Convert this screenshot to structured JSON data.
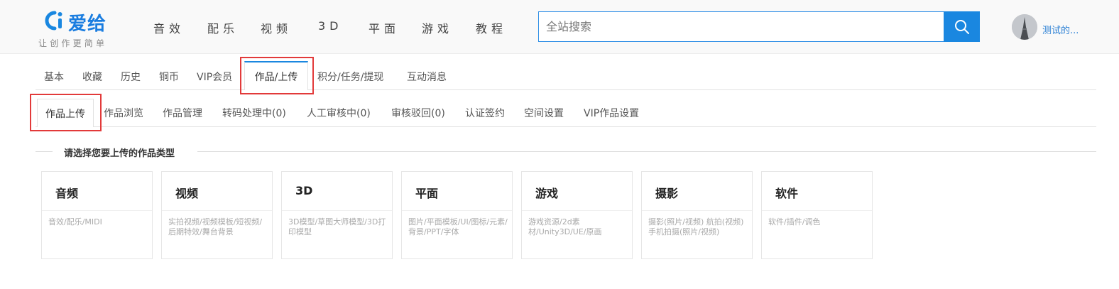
{
  "colors": {
    "brand": "#1a87e0",
    "highlight": "#e23a3a",
    "link": "#2a7fd4"
  },
  "header": {
    "logo": {
      "mark": "Ci",
      "name": "爱给",
      "slogan": "让创作更简单"
    },
    "nav": [
      "音效",
      "配乐",
      "视频",
      "3D",
      "平面",
      "游戏",
      "教程"
    ],
    "search": {
      "placeholder": "全站搜索",
      "icon": "search-icon"
    },
    "user": {
      "name": "测试的..."
    }
  },
  "tabs": {
    "items": [
      "基本",
      "收藏",
      "历史",
      "铜币",
      "VIP会员",
      "作品/上传",
      "积分/任务/提现",
      "互动消息"
    ],
    "active": "作品/上传"
  },
  "subtabs": {
    "items": [
      "作品上传",
      "作品浏览",
      "作品管理",
      "转码处理中(0)",
      "人工审核中(0)",
      "审核驳回(0)",
      "认证签约",
      "空间设置",
      "VIP作品设置"
    ],
    "active": "作品上传"
  },
  "section": {
    "title": "请选择您要上传的作品类型"
  },
  "cards": [
    {
      "title": "音频",
      "desc": "音效/配乐/MIDI"
    },
    {
      "title": "视频",
      "desc": "实拍视频/视频模板/短视频/后期特效/舞台背景"
    },
    {
      "title": "3D",
      "desc": "3D模型/草图大师模型/3D打印模型"
    },
    {
      "title": "平面",
      "desc": "图片/平面模板/UI/图标/元素/背景/PPT/字体"
    },
    {
      "title": "游戏",
      "desc": "游戏资源/2d素材/Unity3D/UE/原画"
    },
    {
      "title": "摄影",
      "desc": "摄影(照片/视频) 航拍(视频) 手机拍摄(照片/视频)"
    },
    {
      "title": "软件",
      "desc": "软件/插件/调色"
    }
  ]
}
